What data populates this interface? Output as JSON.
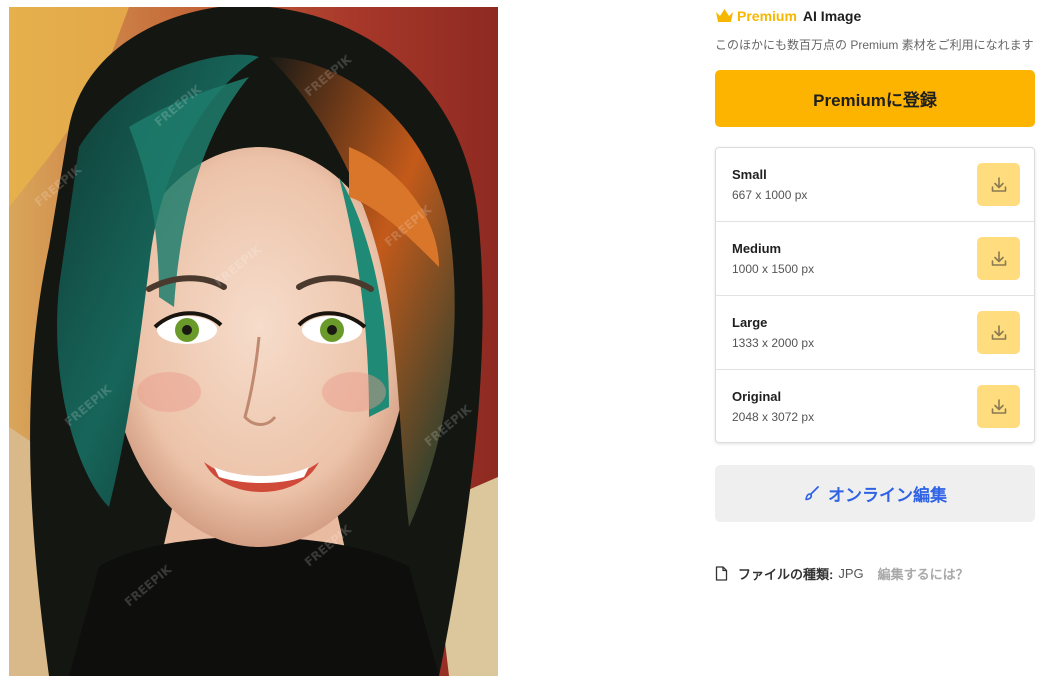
{
  "premium_header": {
    "icon": "crown-icon",
    "premium_label": "Premium",
    "type_label": "AI Image"
  },
  "subtitle": "このほかにも数百万点の Premium 素材をご利用になれます",
  "subscribe_button_label": "Premiumに登録",
  "sizes": [
    {
      "name": "Small",
      "dims": "667 x 1000 px"
    },
    {
      "name": "Medium",
      "dims": "1000 x 1500 px"
    },
    {
      "name": "Large",
      "dims": "1333 x 2000 px"
    },
    {
      "name": "Original",
      "dims": "2048 x 3072 px"
    }
  ],
  "edit_online_label": "オンライン編集",
  "file_info": {
    "label": "ファイルの種類:",
    "type": "JPG",
    "howto_link": "編集するには？"
  },
  "colors": {
    "accent": "#fdb400",
    "download_bg": "#ffdc7e",
    "link_blue": "#2f63e6",
    "premium_text": "#f5b700"
  },
  "preview": {
    "watermark": "FREEPIK"
  }
}
